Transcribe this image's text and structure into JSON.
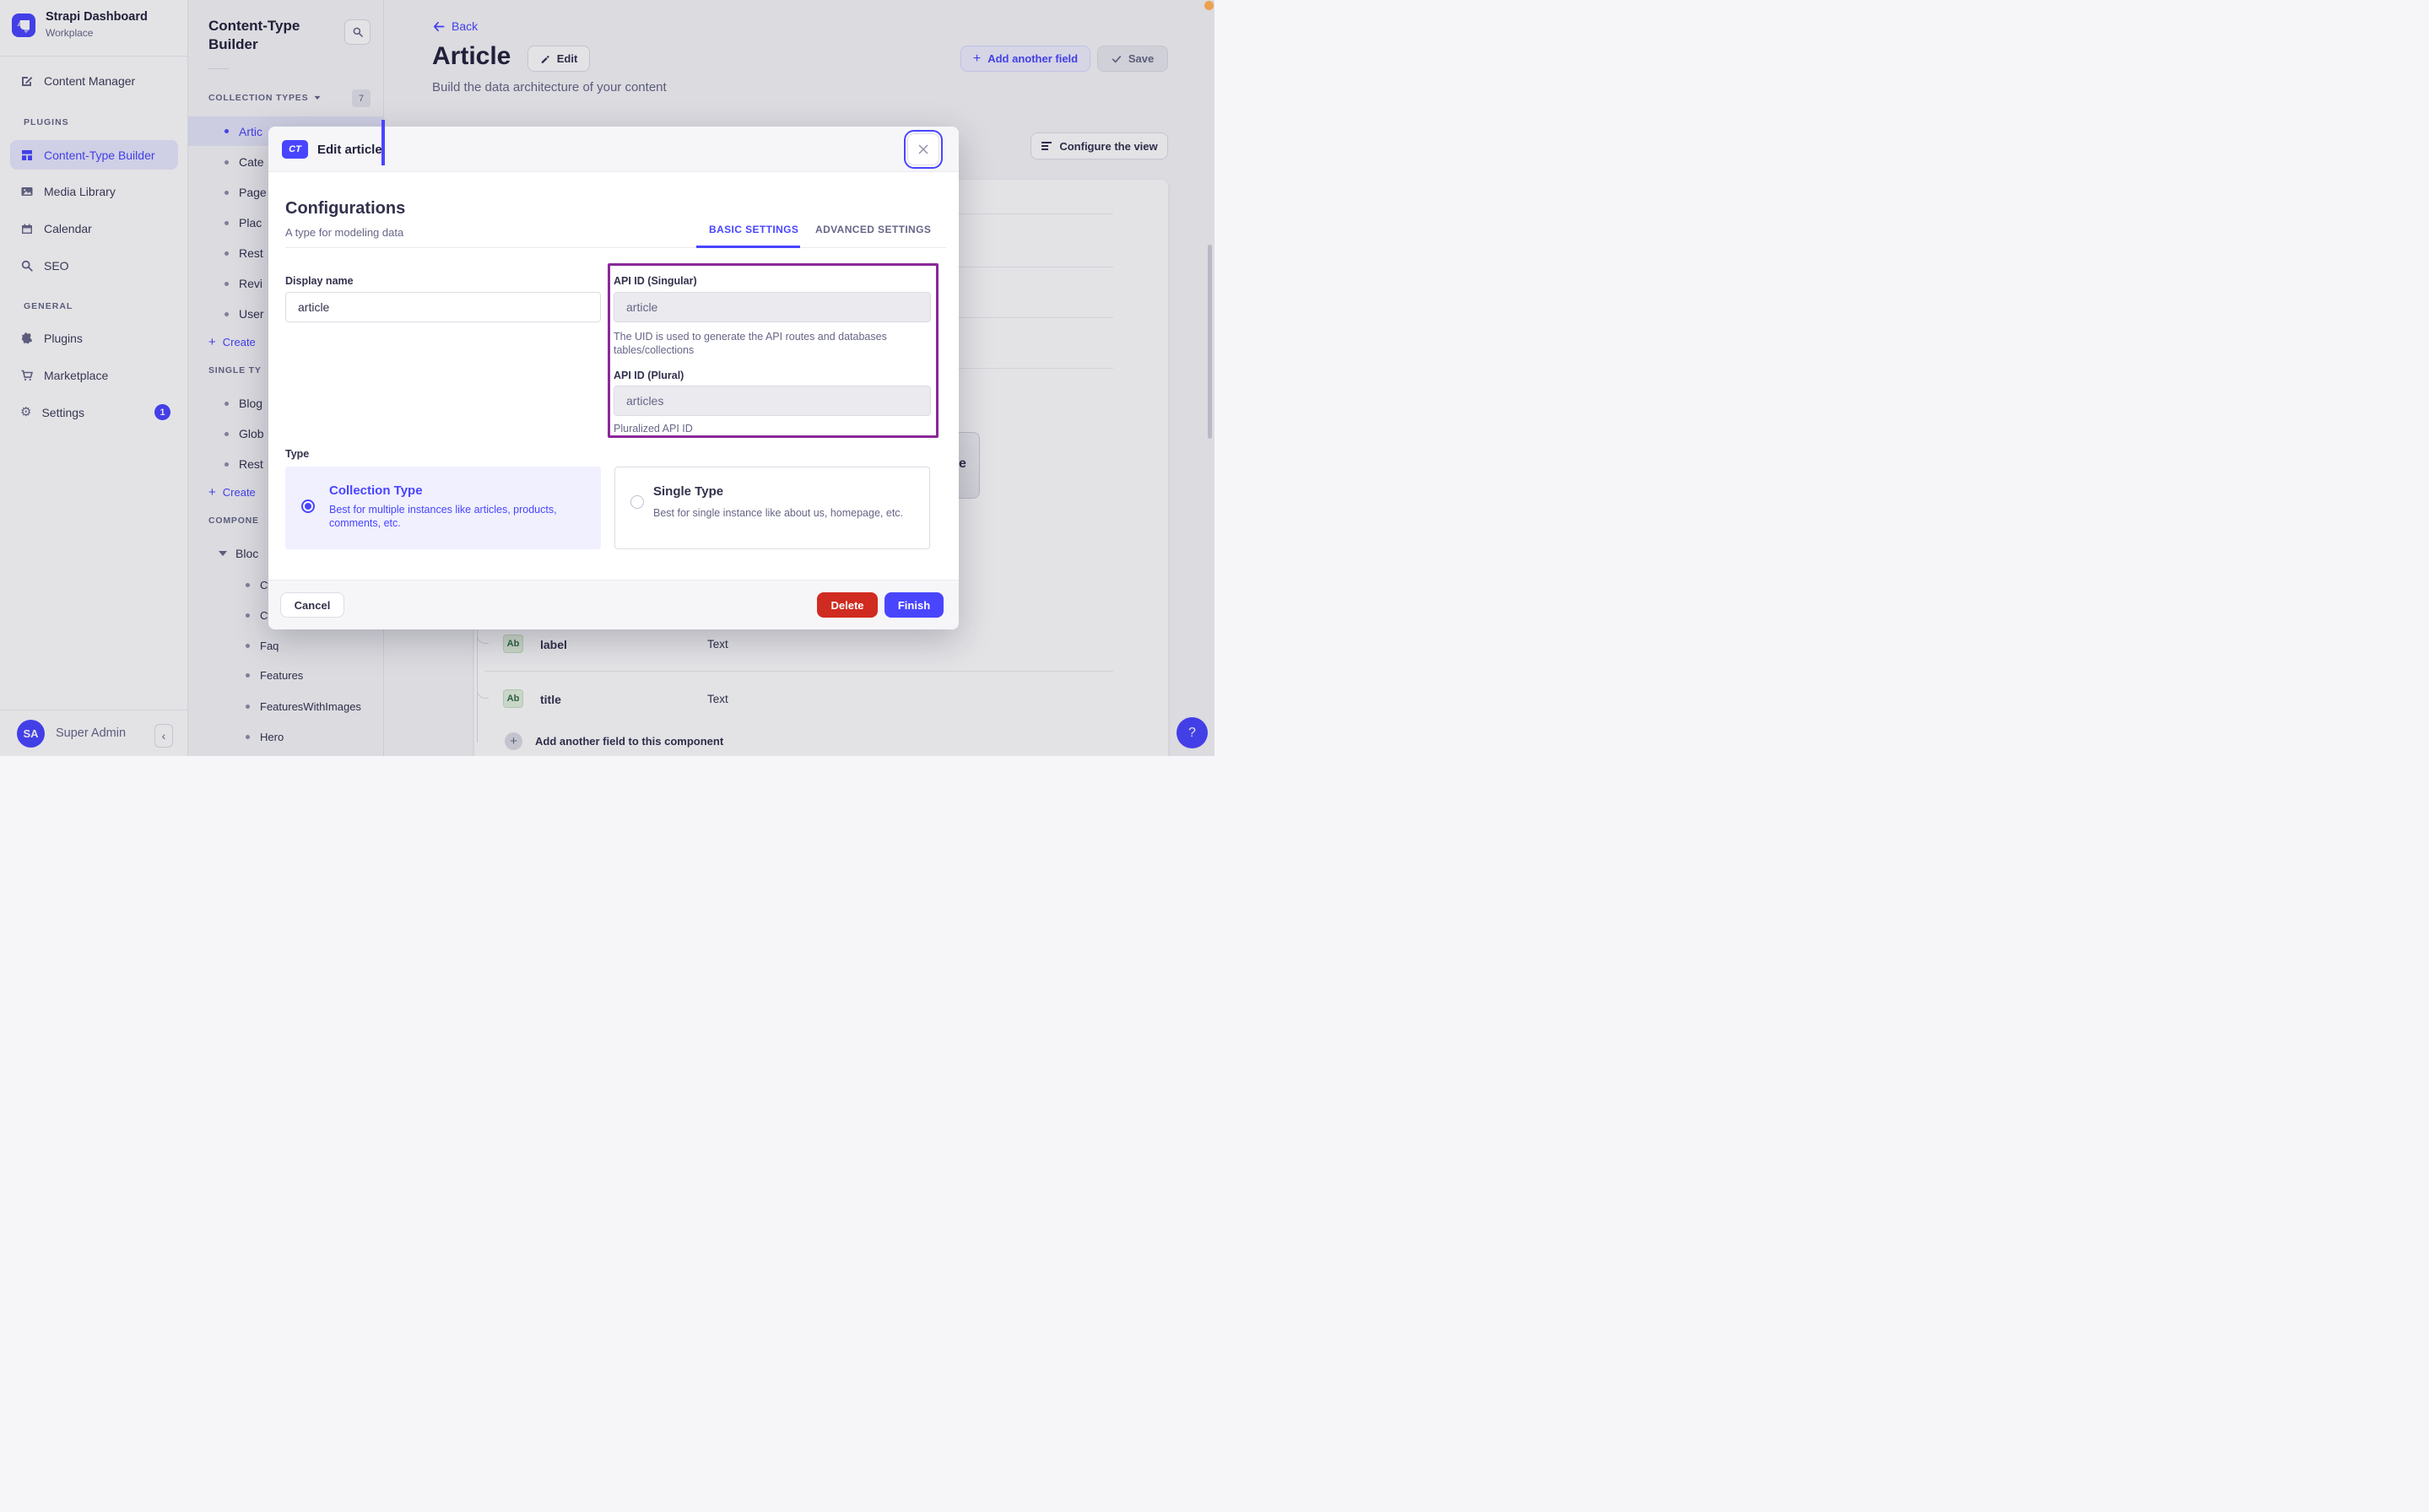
{
  "app": {
    "name": "Strapi Dashboard",
    "workspace": "Workplace"
  },
  "sidebar": {
    "items": [
      {
        "label": "Content Manager"
      }
    ],
    "plugins_header": "PLUGINS",
    "plugins_items": [
      {
        "label": "Content-Type Builder",
        "active": true
      },
      {
        "label": "Media Library"
      },
      {
        "label": "Calendar"
      },
      {
        "label": "SEO"
      }
    ],
    "general_header": "GENERAL",
    "general_items": [
      {
        "label": "Plugins"
      },
      {
        "label": "Marketplace"
      },
      {
        "label": "Settings",
        "badge": "1"
      }
    ],
    "user": {
      "initials": "SA",
      "name": "Super Admin"
    }
  },
  "ctb_panel": {
    "title": "Content-Type Builder",
    "collection_header": "COLLECTION TYPES",
    "collection_count": "7",
    "collection_items": [
      "Artic",
      "Cate",
      "Page",
      "Plac",
      "Rest",
      "Revi",
      "User"
    ],
    "create_collection": "Create",
    "single_header": "SINGLE TY",
    "single_items": [
      "Blog",
      "Glob",
      "Rest"
    ],
    "create_single": "Create",
    "components_header": "COMPONE",
    "component_group": "Bloc",
    "component_items": [
      "Ct",
      "Ct",
      "Faq",
      "Features",
      "FeaturesWithImages",
      "Hero"
    ]
  },
  "main": {
    "back": "Back",
    "title": "Article",
    "edit": "Edit",
    "subtitle": "Build the data architecture of your content",
    "add_field": "Add another field",
    "save": "Save",
    "configure": "Configure the view",
    "partial_text": "e",
    "field_rows": [
      {
        "badge": "Ab",
        "name": "label",
        "type": "Text"
      },
      {
        "badge": "Ab",
        "name": "title",
        "type": "Text"
      }
    ],
    "add_component_field": "Add another field to this component"
  },
  "modal": {
    "badge": "CT",
    "title": "Edit article",
    "heading": "Configurations",
    "subheading": "A type for modeling data",
    "tab_basic": "BASIC SETTINGS",
    "tab_advanced": "ADVANCED SETTINGS",
    "display_name_label": "Display name",
    "display_name_value": "article",
    "api_singular_label": "API ID (Singular)",
    "api_singular_value": "article",
    "api_singular_help": "The UID is used to generate the API routes and databases tables/collections",
    "api_plural_label": "API ID (Plural)",
    "api_plural_value": "articles",
    "api_plural_help": "Pluralized API ID",
    "type_label": "Type",
    "collection_type": {
      "title": "Collection Type",
      "desc": "Best for multiple instances like articles, products, comments, etc."
    },
    "single_type": {
      "title": "Single Type",
      "desc": "Best for single instance like about us, homepage, etc."
    },
    "cancel": "Cancel",
    "delete": "Delete",
    "finish": "Finish"
  },
  "help_label": "?",
  "colors": {
    "primary": "#4945ff",
    "danger": "#d02b20",
    "annotation": "#8a2899",
    "os_dot": "#eca14e"
  }
}
